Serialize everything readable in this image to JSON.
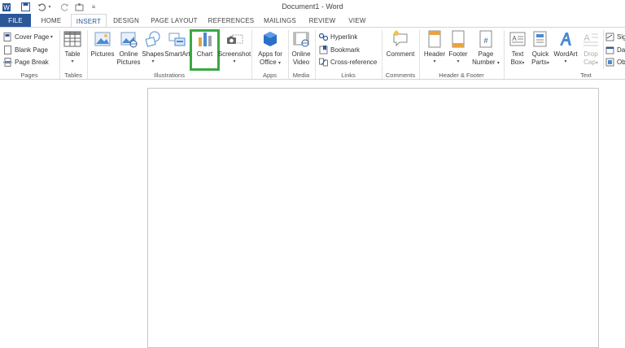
{
  "title_bar": {
    "document_title": "Document1 - Word"
  },
  "tabs": [
    "FILE",
    "HOME",
    "INSERT",
    "DESIGN",
    "PAGE LAYOUT",
    "REFERENCES",
    "MAILINGS",
    "REVIEW",
    "VIEW"
  ],
  "active_tab": "INSERT",
  "ribbon": {
    "pages": {
      "label": "Pages",
      "cover_page": "Cover Page",
      "blank_page": "Blank Page",
      "page_break": "Page Break"
    },
    "tables": {
      "label": "Tables",
      "table": "Table"
    },
    "illustrations": {
      "label": "Illustrations",
      "pictures": "Pictures",
      "online_pictures_1": "Online",
      "online_pictures_2": "Pictures",
      "shapes": "Shapes",
      "smartart": "SmartArt",
      "chart": "Chart",
      "screenshot": "Screenshot"
    },
    "apps": {
      "label": "Apps",
      "apps_1": "Apps for",
      "apps_2": "Office"
    },
    "media": {
      "label": "Media",
      "video_1": "Online",
      "video_2": "Video"
    },
    "links": {
      "label": "Links",
      "hyperlink": "Hyperlink",
      "bookmark": "Bookmark",
      "cross_reference": "Cross-reference"
    },
    "comments": {
      "label": "Comments",
      "comment": "Comment"
    },
    "header_footer": {
      "label": "Header & Footer",
      "header": "Header",
      "footer": "Footer",
      "page_number_1": "Page",
      "page_number_2": "Number"
    },
    "text": {
      "label": "Text",
      "text_box_1": "Text",
      "text_box_2": "Box",
      "quick_parts_1": "Quick",
      "quick_parts_2": "Parts",
      "wordart": "WordArt",
      "drop_cap_1": "Drop",
      "drop_cap_2": "Cap",
      "signature": "Sig",
      "date": "Dat",
      "object": "Obj"
    }
  },
  "colors": {
    "accent": "#2b579a",
    "highlight": "#3aa845"
  }
}
